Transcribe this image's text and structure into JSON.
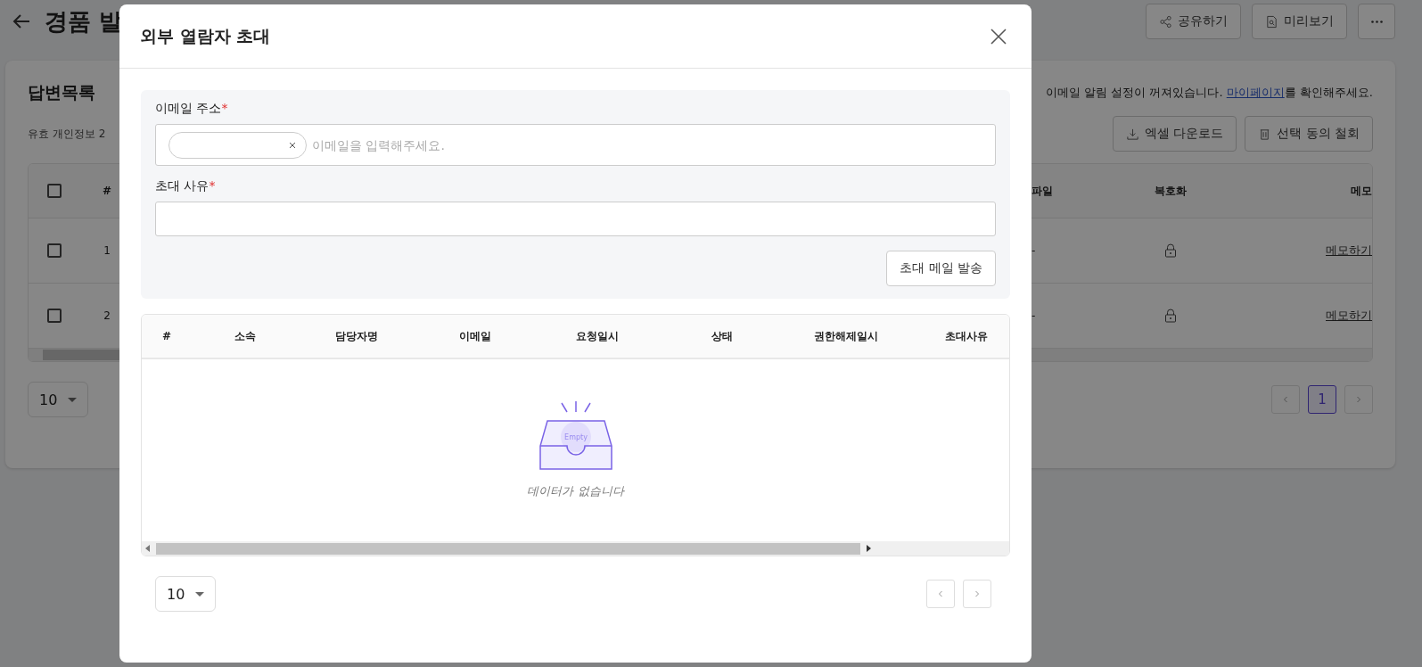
{
  "page": {
    "title": "경품 발",
    "actions": [
      {
        "label": "공유하기"
      },
      {
        "label": "미리보기"
      }
    ]
  },
  "card": {
    "title": "답변목록",
    "notice_before": "이메일 알림 설정이 꺼져있습니다. ",
    "notice_link": "마이페이지",
    "notice_after": "를 확인해주세요.",
    "count": "유효 개인정보 2",
    "buttons": [
      {
        "label": "엑셀 다운로드"
      },
      {
        "label": "선택 동의 철회"
      }
    ],
    "table": {
      "header_checked": false,
      "columns": [
        "#",
        "파일",
        "복호화",
        "메모"
      ],
      "rows": [
        {
          "checked": false,
          "number": "1",
          "file": "-",
          "locked": true,
          "memo": "메모하기"
        },
        {
          "checked": false,
          "number": "2",
          "file": "-",
          "locked": true,
          "memo": "메모하기"
        }
      ]
    },
    "page_size": "10",
    "pages": [
      {
        "label": "1",
        "selected": true
      }
    ]
  },
  "modal": {
    "title": "외부 열람자 초대",
    "fields": [
      {
        "label": "이메일 주소",
        "mark": "*",
        "kind": "tags",
        "placeholder": "이메일을 입력해주세요.",
        "tags": [
          {
            "kind": "blank"
          }
        ]
      },
      {
        "label": "초대 사유",
        "mark": "*",
        "kind": "text"
      }
    ],
    "submit": "초대 메일 발송",
    "table": {
      "columns": [
        "#",
        "소속",
        "담당자명",
        "이메일",
        "요청일시",
        "상태",
        "권한해제일시",
        "초대사유"
      ],
      "empty_image_label": "Empty",
      "empty_text": "데이터가 없습니다"
    },
    "page_size": "10"
  }
}
